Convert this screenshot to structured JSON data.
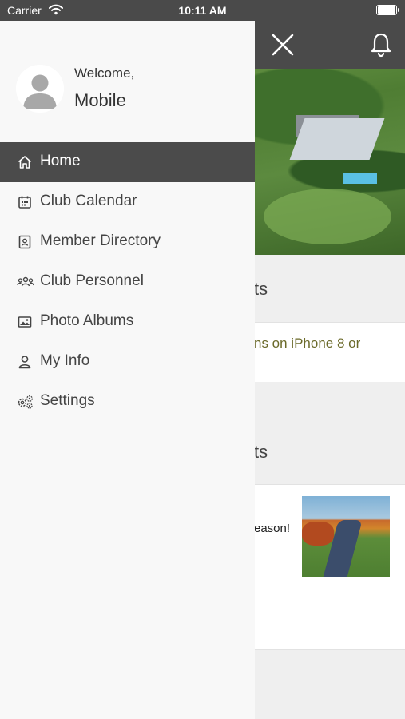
{
  "status_bar": {
    "carrier": "Carrier",
    "time": "10:11 AM"
  },
  "drawer": {
    "welcome": "Welcome,",
    "username": "Mobile",
    "menu": [
      {
        "label": "Home",
        "icon": "home-icon",
        "active": true
      },
      {
        "label": "Club Calendar",
        "icon": "calendar-icon",
        "active": false
      },
      {
        "label": "Member Directory",
        "icon": "contact-card-icon",
        "active": false
      },
      {
        "label": "Club Personnel",
        "icon": "people-group-icon",
        "active": false
      },
      {
        "label": "Photo Albums",
        "icon": "photo-icon",
        "active": false
      },
      {
        "label": "My Info",
        "icon": "person-icon",
        "active": false
      },
      {
        "label": "Settings",
        "icon": "gears-icon",
        "active": false
      }
    ]
  },
  "main": {
    "section1_title_fragment": "ts",
    "section1_item_fragment": "ns on iPhone 8 or",
    "section2_title_fragment": "ts",
    "section2_item_fragment": "eason!"
  },
  "colors": {
    "header_bg": "#4a4a4a",
    "active_item_bg": "#4b4b4b",
    "drawer_bg": "#f8f8f8",
    "olive_text": "#6b6a2a"
  }
}
